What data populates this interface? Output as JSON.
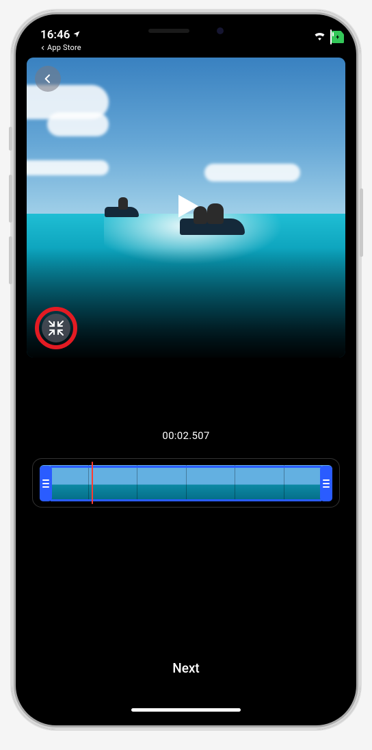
{
  "status": {
    "time": "16:46",
    "breadcrumb": "App Store"
  },
  "editor": {
    "timecode": "00:02.507",
    "next_label": "Next"
  },
  "icons": {
    "back": "chevron-left",
    "play": "play",
    "collapse": "arrows-in",
    "wifi": "wifi",
    "location": "location",
    "battery_bolt": "bolt"
  },
  "annotation": {
    "highlight": "collapse-button"
  },
  "timeline": {
    "thumbs": 6
  },
  "colors": {
    "trim_handle": "#2a5cff",
    "playhead": "#ff3b30",
    "battery_fill": "#34c759",
    "annotation_ring": "#e31b23"
  }
}
